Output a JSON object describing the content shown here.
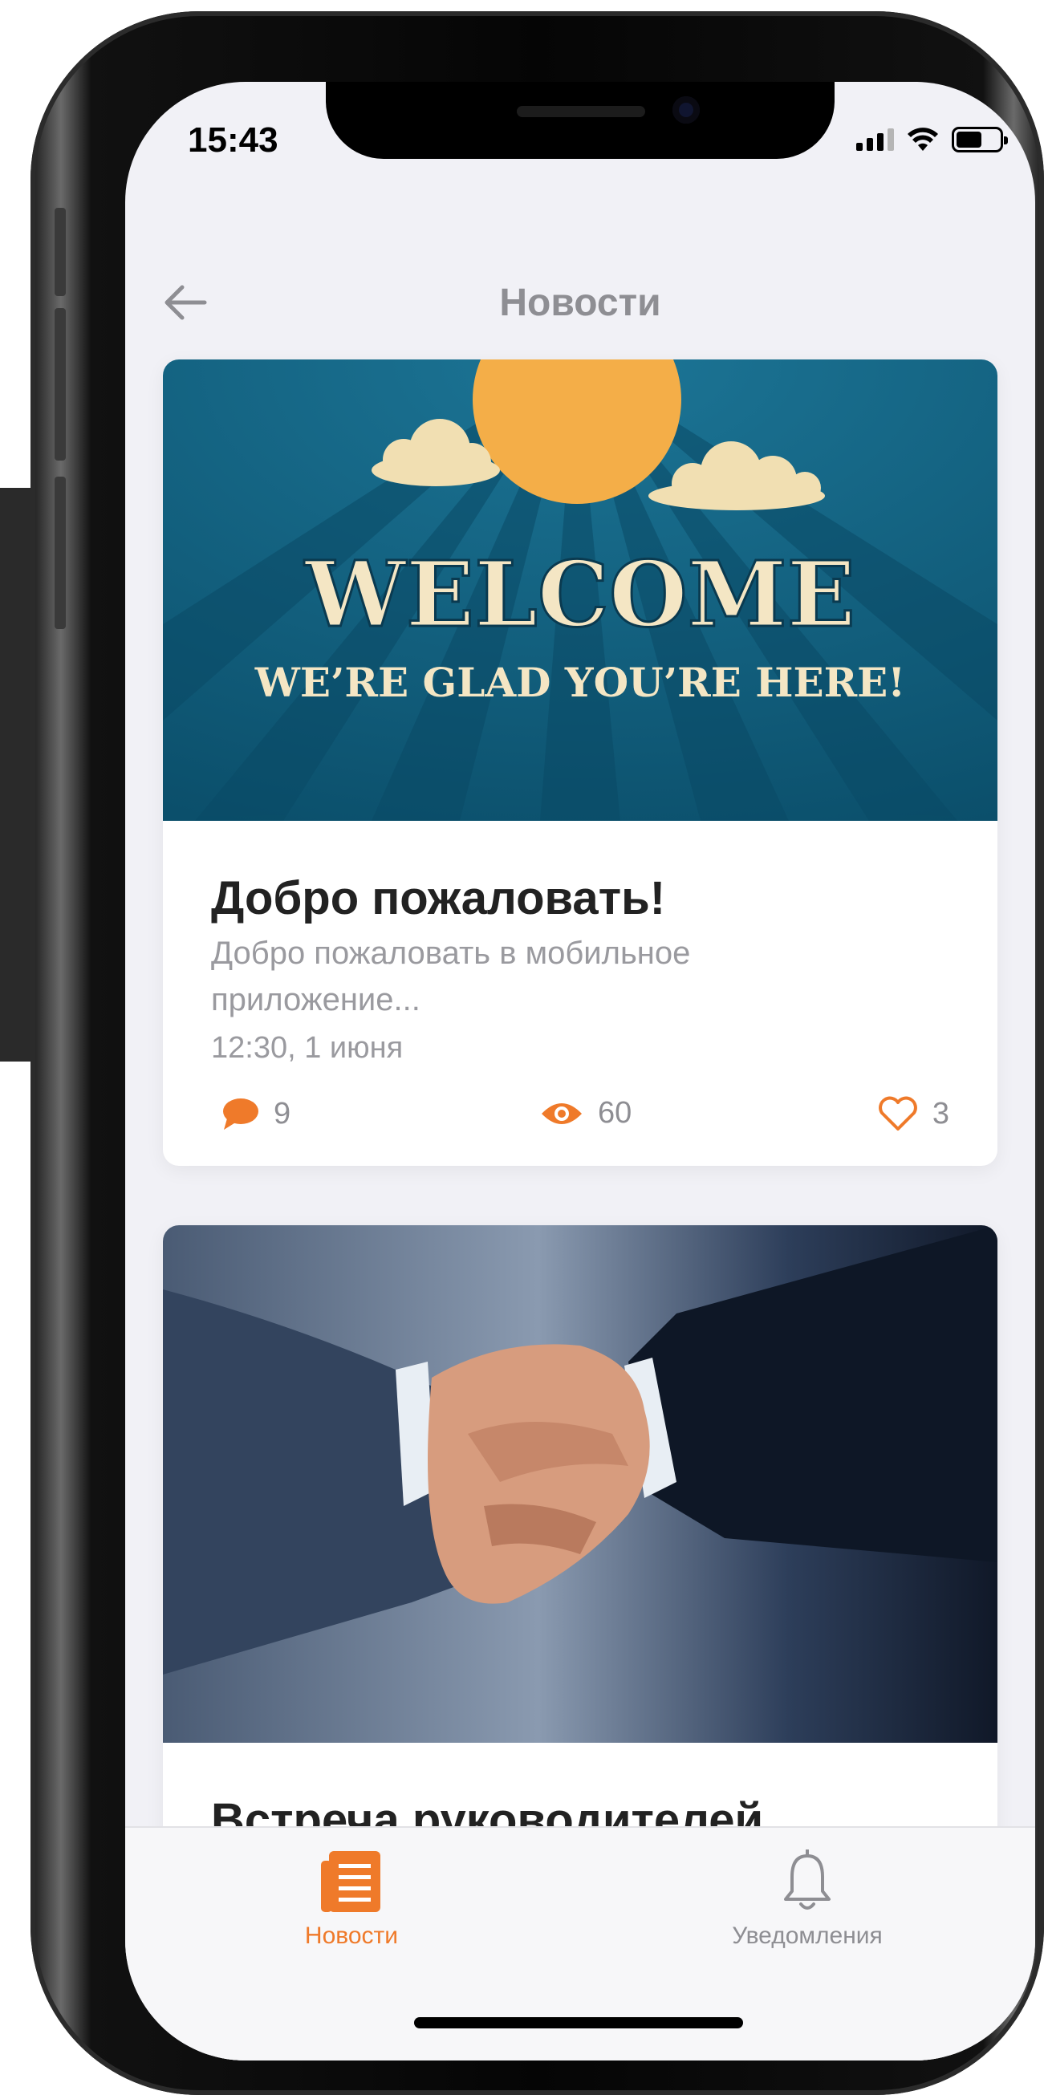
{
  "status_bar": {
    "time": "15:43"
  },
  "nav": {
    "title": "Новости",
    "back_icon": "arrow-left-icon"
  },
  "posts": [
    {
      "image_text_main": "WELCOME",
      "image_text_sub": "WE’RE GLAD YOU’RE HERE!",
      "title": "Добро пожаловать!",
      "excerpt": "Добро пожаловать в мобильное приложение...",
      "datetime": "12:30, 1 июня",
      "comments": "9",
      "views": "60",
      "likes": "3"
    },
    {
      "title": "Встреча руководителей"
    }
  ],
  "tabbar": {
    "items": [
      {
        "label": "Новости",
        "icon": "news-list-icon",
        "active": true
      },
      {
        "label": "Уведомления",
        "icon": "bell-icon",
        "active": false
      }
    ]
  },
  "colors": {
    "accent": "#ef7a2a",
    "screen_bg": "#f1f1f6",
    "muted_text": "#9a9a9f",
    "welcome_bg": "#0f5d7c",
    "sun": "#f4ae48"
  }
}
